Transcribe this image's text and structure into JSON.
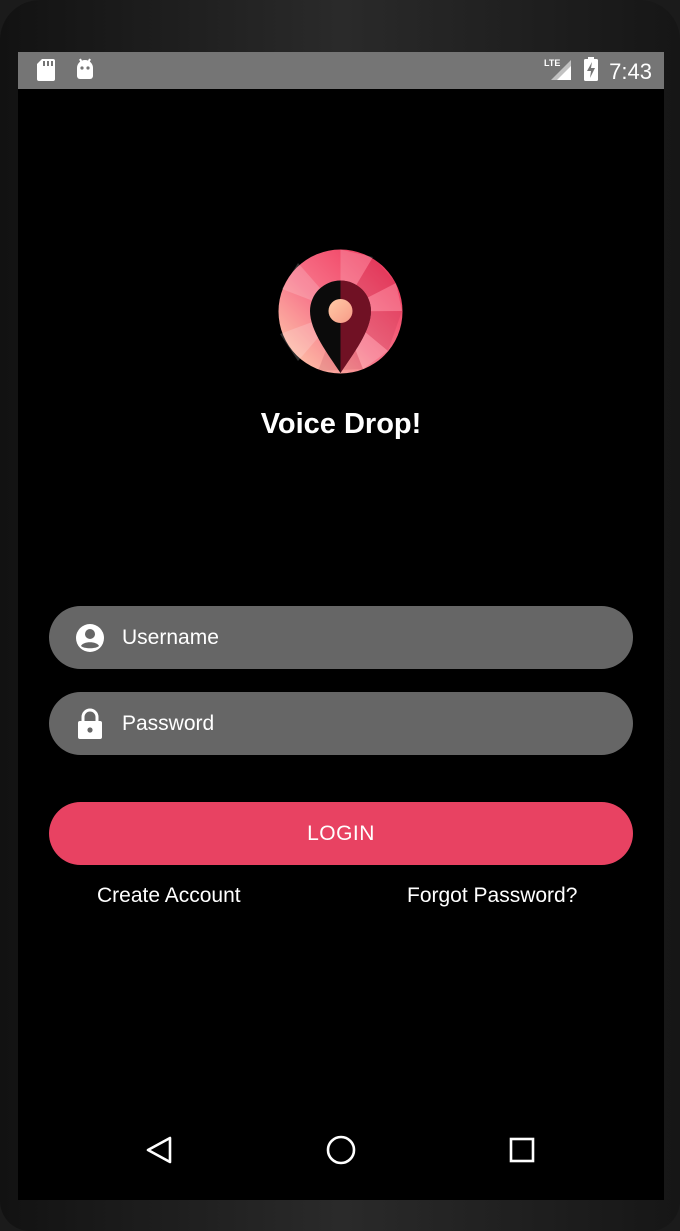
{
  "status_bar": {
    "time": "7:43",
    "left_icons": [
      "sd-card-icon",
      "android-icon"
    ],
    "right_icons": [
      "lte-signal-icon",
      "battery-charging-icon"
    ]
  },
  "app": {
    "name": "Voice Drop!",
    "logo_icon": "location-pin-logo-icon"
  },
  "form": {
    "username": {
      "placeholder": "Username",
      "value": "",
      "icon": "account-circle-icon"
    },
    "password": {
      "placeholder": "Password",
      "value": "",
      "icon": "lock-icon"
    },
    "login_label": "LOGIN",
    "create_account_label": "Create Account",
    "forgot_password_label": "Forgot Password?"
  },
  "nav_bar": {
    "icons": [
      "back-triangle-icon",
      "home-circle-icon",
      "recents-square-icon"
    ]
  },
  "colors": {
    "accent": "#e84262",
    "field_background": "#666666",
    "screen_background": "#000000",
    "status_bar": "#757575"
  }
}
